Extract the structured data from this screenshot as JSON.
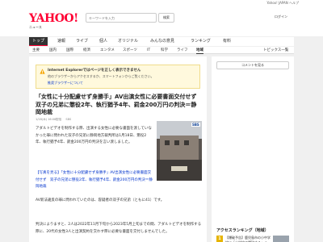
{
  "topbar": {
    "links": "Yahoo! JAPAN ヘルプ"
  },
  "header": {
    "logo_text": "YAHOO!",
    "logo_sub": "ニュース",
    "search_placeholder": "キーワードを入力",
    "search_button": "検索",
    "right_text": "ログイン"
  },
  "nav": {
    "items": [
      {
        "label": "トップ",
        "active": true
      },
      {
        "label": "速報"
      },
      {
        "label": "ライブ"
      },
      {
        "label": "個人"
      },
      {
        "label": "オリジナル"
      },
      {
        "label": "みんなの意見"
      },
      {
        "label": "ランキング"
      },
      {
        "label": "有料"
      }
    ]
  },
  "subnav": {
    "items": [
      {
        "label": "主要"
      },
      {
        "label": "国内"
      },
      {
        "label": "国際"
      },
      {
        "label": "経済"
      },
      {
        "label": "エンタメ"
      },
      {
        "label": "スポーツ"
      },
      {
        "label": "IT"
      },
      {
        "label": "科学"
      },
      {
        "label": "ライフ"
      },
      {
        "label": "地域",
        "active": true
      }
    ],
    "right": "トピックス一覧"
  },
  "ie_notice": {
    "title": "Internet Explorerではページを正しく表示できません",
    "desc": "他のブラウザーからアクセスするか、スマートフォンからご覧ください。",
    "link": "推奨ブラウザーについて"
  },
  "article": {
    "title": "「女性に十分配慮せず身勝手」AV出演女性に必要書面交付せず　双子の兄弟に懲役2年、執行猶予4年、罰金200万円の判決＝静岡地裁",
    "date": "1/18(木) 16:08配信",
    "source": "SBS",
    "para1": "アダルトビデオを制作する際、出演する女性に必要な書面を渡していなかった罪に問われた双子の兄弟に静岡地方裁判所は1月18日、懲役2年、執行猶予4年、罰金200万円の判決を言い渡しました。",
    "related": "【写真を見る】「女性に十分配慮せず身勝手」AV出演女性に必要書面交付せず　双子の兄弟に懲役2年、執行猶予4年、罰金200万円の判決＝静岡地裁",
    "para2": "AV新法違反の罪に問われていたのは、容疑者の双子の兄弟（ともに41）です。",
    "para3": "判決によりますと、2人は2022年11月下旬から2023年5月上旬までの間、アダルトビデオを制作する際に、20代の女性3人と出演契約を交わす際に必要な書面を交付しませんでした。",
    "photo_logo": "SBS"
  },
  "side": {
    "button": "コメントを見る",
    "ranking_title": "アクセスランキング（地域）",
    "rank1": {
      "num": "1",
      "text": "【爆破予告】鹿児島市の小中学校に「小学校で爆破する」メール"
    }
  },
  "colors": {
    "brand": "#ff0033",
    "link": "#0033cc",
    "notice_bg": "#fff9dd"
  }
}
